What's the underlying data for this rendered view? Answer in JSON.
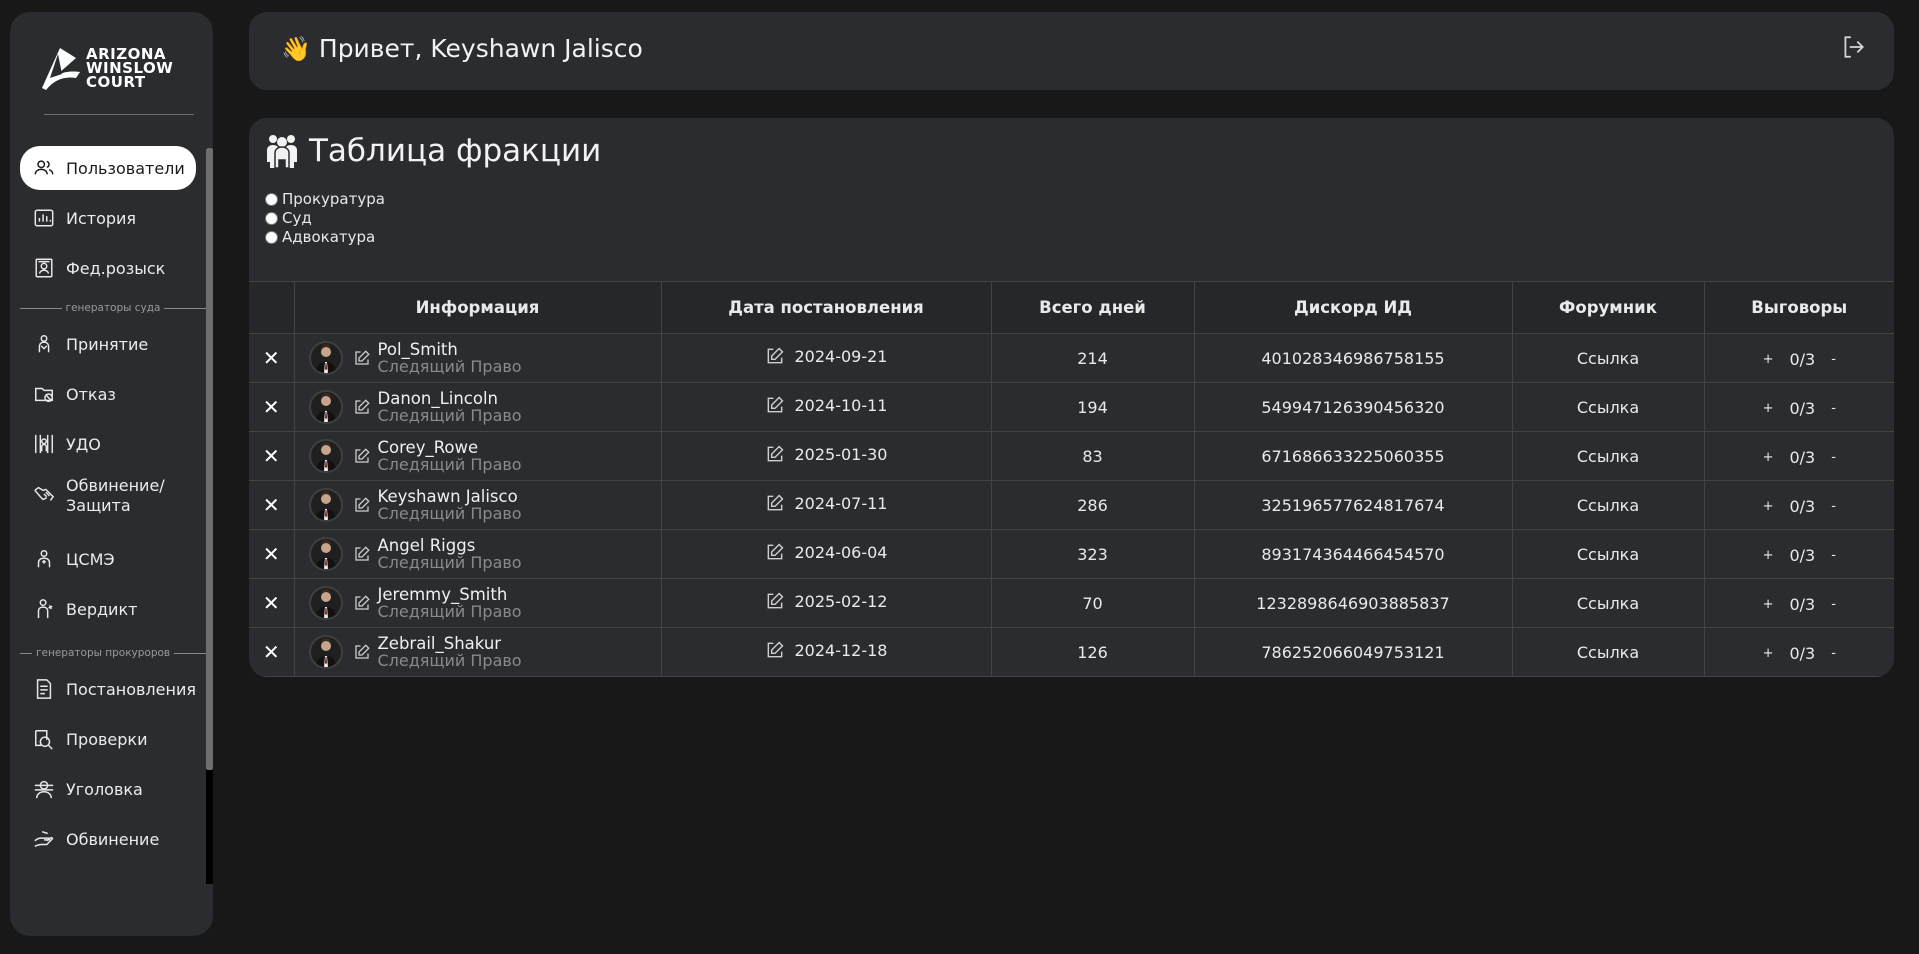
{
  "brand": {
    "line1": "ARIZONA",
    "line2": "WINSLOW",
    "line3": "COURT"
  },
  "sidebar": {
    "items": [
      {
        "label": "Пользователи",
        "icon": "users-icon"
      },
      {
        "label": "История",
        "icon": "chart-icon"
      },
      {
        "label": "Фед.розыск",
        "icon": "wanted-icon"
      },
      {
        "label": "Принятие",
        "icon": "accept-icon"
      },
      {
        "label": "Отказ",
        "icon": "refuse-icon"
      },
      {
        "label": "УДО",
        "icon": "jail-icon"
      },
      {
        "label": "Обвинение/ Защита",
        "icon": "handshake-icon"
      },
      {
        "label": "ЦСМЭ",
        "icon": "doctor-icon"
      },
      {
        "label": "Вердикт",
        "icon": "judge-icon"
      },
      {
        "label": "Постановления",
        "icon": "document-icon"
      },
      {
        "label": "Проверки",
        "icon": "inspect-icon"
      },
      {
        "label": "Уголовка",
        "icon": "criminal-icon"
      },
      {
        "label": "Обвинение",
        "icon": "accuse-icon"
      }
    ],
    "groups": {
      "court": "генераторы суда",
      "prosecutors": "генераторы прокуроров"
    }
  },
  "header": {
    "wave": "👋",
    "greeting": "Привет, Keyshawn Jalisco"
  },
  "panel": {
    "title": "Таблица фракции",
    "radios": [
      "Прокуратура",
      "Суд",
      "Адвокатура"
    ]
  },
  "table": {
    "columns": [
      "Информация",
      "Дата постановления",
      "Всего дней",
      "Дискорд ИД",
      "Форумник",
      "Выговоры"
    ],
    "rows": [
      {
        "name": "Pol_Smith",
        "role": "Следящий Право",
        "date": "2024-09-21",
        "days": "214",
        "discord": "401028346986758155",
        "forum": "Ссылка",
        "warns": "0/3"
      },
      {
        "name": "Danon_Lincoln",
        "role": "Следящий Право",
        "date": "2024-10-11",
        "days": "194",
        "discord": "549947126390456320",
        "forum": "Ссылка",
        "warns": "0/3"
      },
      {
        "name": "Corey_Rowe",
        "role": "Следящий Право",
        "date": "2025-01-30",
        "days": "83",
        "discord": "671686633225060355",
        "forum": "Ссылка",
        "warns": "0/3"
      },
      {
        "name": "Keyshawn Jalisco",
        "role": "Следящий Право",
        "date": "2024-07-11",
        "days": "286",
        "discord": "325196577624817674",
        "forum": "Ссылка",
        "warns": "0/3"
      },
      {
        "name": "Angel Riggs",
        "role": "Следящий Право",
        "date": "2024-06-04",
        "days": "323",
        "discord": "893174364466454570",
        "forum": "Ссылка",
        "warns": "0/3"
      },
      {
        "name": "Jeremmy_Smith",
        "role": "Следящий Право",
        "date": "2025-02-12",
        "days": "70",
        "discord": "1232898646903885837",
        "forum": "Ссылка",
        "warns": "0/3"
      },
      {
        "name": "Zebrail_Shakur",
        "role": "Следящий Право",
        "date": "2024-12-18",
        "days": "126",
        "discord": "786252066049753121",
        "forum": "Ссылка",
        "warns": "0/3"
      }
    ],
    "plus": "+",
    "minus": "-",
    "remove": "✕"
  }
}
